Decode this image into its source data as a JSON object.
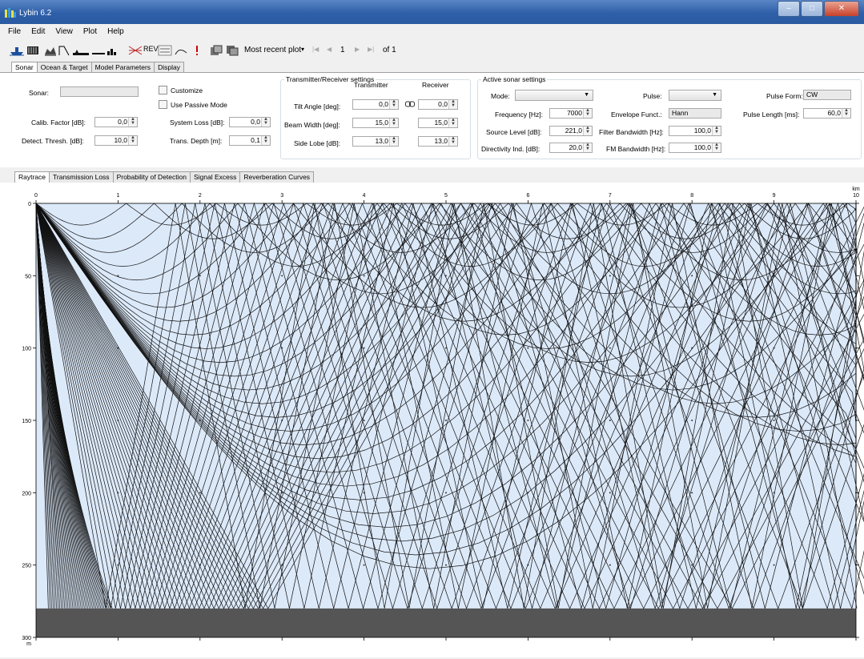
{
  "window": {
    "title": "Lybin 6.2"
  },
  "menu": [
    "File",
    "Edit",
    "View",
    "Plot",
    "Help"
  ],
  "toolbar": {
    "rev_label": "REV",
    "recent_label": "Most recent plot",
    "page_current": "1",
    "page_total": "of 1"
  },
  "main_tabs": [
    "Sonar",
    "Ocean & Target",
    "Model Parameters",
    "Display"
  ],
  "sonar": {
    "sonar_label": "Sonar:",
    "calib_label": "Calib. Factor [dB]:",
    "calib_value": "0,0",
    "detect_label": "Detect. Thresh. [dB]:",
    "detect_value": "10,0",
    "customize_label": "Customize",
    "passive_label": "Use Passive Mode",
    "sysloss_label": "System Loss [dB]:",
    "sysloss_value": "0,0",
    "transdepth_label": "Trans. Depth [m]:",
    "transdepth_value": "0,1"
  },
  "txrx": {
    "title": "Transmitter/Receiver settings",
    "tx_header": "Transmitter",
    "rx_header": "Receiver",
    "tilt_label": "Tilt Angle [deg]:",
    "tilt_tx": "0,0",
    "tilt_rx": "0,0",
    "beam_label": "Beam Width [deg]:",
    "beam_tx": "15,0",
    "beam_rx": "15,0",
    "side_label": "Side Lobe [dB]:",
    "side_tx": "13,0",
    "side_rx": "13,0"
  },
  "active": {
    "title": "Active sonar settings",
    "mode_label": "Mode:",
    "freq_label": "Frequency [Hz]:",
    "freq_value": "7000",
    "source_label": "Source Level [dB]:",
    "source_value": "221,0",
    "di_label": "Directivity Ind. [dB]:",
    "di_value": "20,0",
    "pulse_label": "Pulse:",
    "env_label": "Envelope Funct.:",
    "env_value": "Hann",
    "filter_label": "Filter Bandwidth [Hz]:",
    "filter_value": "100,0",
    "fm_label": "FM Bandwidth [Hz]:",
    "fm_value": "100,0",
    "pform_label": "Pulse Form:",
    "pform_value": "CW",
    "plen_label": "Pulse Length [ms]:",
    "plen_value": "60,0"
  },
  "plot_tabs": [
    "Raytrace",
    "Transmission Loss",
    "Probability of Detection",
    "Signal Excess",
    "Reverberation Curves"
  ],
  "plot": {
    "x_ticks": [
      "0",
      "1",
      "2",
      "3",
      "4",
      "5",
      "6",
      "7",
      "8",
      "9",
      "10"
    ],
    "x_unit": "km",
    "y_ticks": [
      "0",
      "50",
      "100",
      "150",
      "200",
      "250",
      "300"
    ],
    "y_unit": "m",
    "bottom_depth_m": 280,
    "max_depth_m": 300,
    "max_range_km": 10,
    "colors": {
      "water": "#dce9f9",
      "bottom": "#555555",
      "ray": "#111111"
    }
  }
}
